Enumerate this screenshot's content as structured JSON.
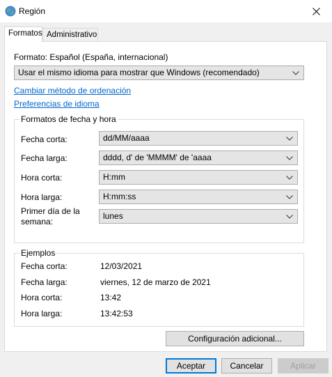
{
  "window": {
    "title": "Región"
  },
  "tabs": [
    {
      "label": "Formatos"
    },
    {
      "label": "Administrativo"
    }
  ],
  "format": {
    "label": "Formato: Español (España, internacional)",
    "selected": "Usar el mismo idioma para mostrar que Windows (recomendado)"
  },
  "links": {
    "sort_method": "Cambiar método de ordenación",
    "language_prefs": "Preferencias de idioma"
  },
  "datetime": {
    "legend": "Formatos de fecha y hora",
    "rows": [
      {
        "label": "Fecha corta:",
        "value": "dd/MM/aaaa"
      },
      {
        "label": "Fecha larga:",
        "value": "dddd, d' de 'MMMM' de 'aaaa"
      },
      {
        "label": "Hora corta:",
        "value": "H:mm"
      },
      {
        "label": "Hora larga:",
        "value": "H:mm:ss"
      },
      {
        "label_line1": "Primer día de la",
        "label_line2": "semana:",
        "value": "lunes"
      }
    ]
  },
  "examples": {
    "legend": "Ejemplos",
    "rows": [
      {
        "label": "Fecha corta:",
        "value": "12/03/2021"
      },
      {
        "label": "Fecha larga:",
        "value": "viernes, 12 de marzo de 2021"
      },
      {
        "label": "Hora corta:",
        "value": "13:42"
      },
      {
        "label": "Hora larga:",
        "value": "13:42:53"
      }
    ]
  },
  "buttons": {
    "additional": "Configuración adicional...",
    "accept": "Aceptar",
    "cancel": "Cancelar",
    "apply": "Aplicar"
  },
  "colors": {
    "link": "#0066cc",
    "accent": "#0078d7"
  }
}
